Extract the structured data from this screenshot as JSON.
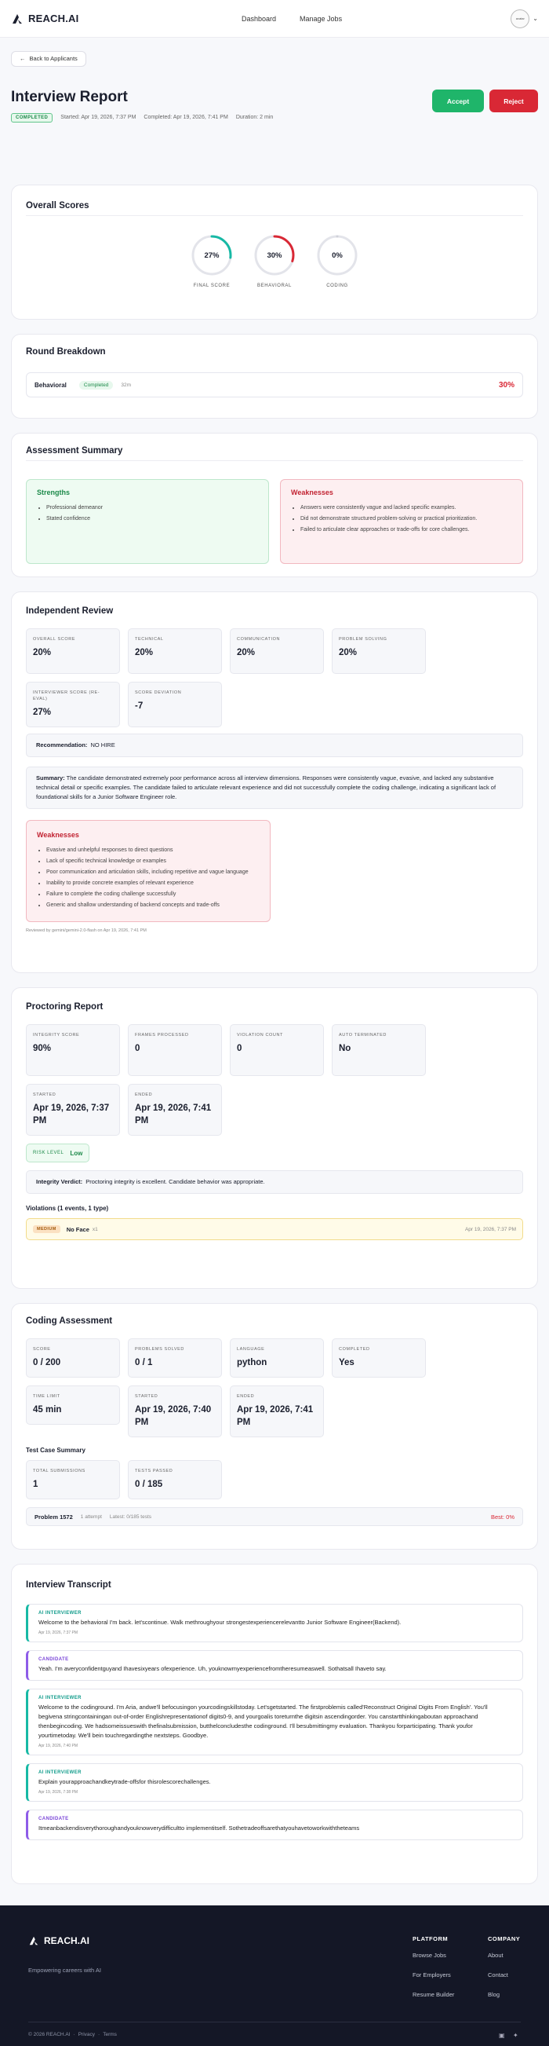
{
  "nav": {
    "brand": "REACH.AI",
    "links": [
      "Dashboard",
      "Manage Jobs"
    ],
    "avatar": "avatar"
  },
  "hero": {
    "back": "Back to Applicants",
    "title": "Interview Report",
    "status": "COMPLETED",
    "started": "Started: Apr 19, 2026, 7:37 PM",
    "completed": "Completed: Apr 19, 2026, 7:41 PM",
    "duration": "Duration: 2 min",
    "accept": "Accept",
    "reject": "Reject"
  },
  "overall": {
    "title": "Overall Scores",
    "gauges": [
      {
        "value": "27%",
        "label": "FINAL SCORE",
        "pct": 27,
        "color": "#17b9a5"
      },
      {
        "value": "30%",
        "label": "BEHAVIORAL",
        "pct": 30,
        "color": "#d92835"
      },
      {
        "value": "0%",
        "label": "CODING",
        "pct": 0,
        "color": "#cfd0d8"
      }
    ]
  },
  "rounds": {
    "title": "Round Breakdown",
    "items": [
      {
        "name": "Behavioral",
        "status": "Completed",
        "time": "32m",
        "score": "30%"
      }
    ]
  },
  "summary": {
    "title": "Assessment Summary",
    "strengths_title": "Strengths",
    "strengths": [
      "Professional demeanor",
      "Stated confidence"
    ],
    "weaknesses_title": "Weaknesses",
    "weaknesses": [
      "Answers were consistently vague and lacked specific examples.",
      "Did not demonstrate structured problem-solving or practical prioritization.",
      "Failed to articulate clear approaches or trade-offs for core challenges."
    ]
  },
  "review": {
    "title": "Independent Review",
    "metrics": [
      {
        "label": "OVERALL SCORE",
        "value": "20%"
      },
      {
        "label": "TECHNICAL",
        "value": "20%"
      },
      {
        "label": "COMMUNICATION",
        "value": "20%"
      },
      {
        "label": "PROBLEM SOLVING",
        "value": "20%"
      },
      {
        "label": "INTERVIEWER SCORE (RE-EVAL)",
        "value": "27%"
      },
      {
        "label": "SCORE DEVIATION",
        "value": "-7"
      }
    ],
    "rec_label": "Recommendation:",
    "rec_value": "NO HIRE",
    "summary_label": "Summary:",
    "summary_text": "The candidate demonstrated extremely poor performance across all interview dimensions. Responses were consistently vague, evasive, and lacked any substantive technical detail or specific examples. The candidate failed to articulate relevant experience and did not successfully complete the coding challenge, indicating a significant lack of foundational skills for a Junior Software Engineer role.",
    "weak_title": "Weaknesses",
    "weaknesses": [
      "Evasive and unhelpful responses to direct questions",
      "Lack of specific technical knowledge or examples",
      "Poor communication and articulation skills, including repetitive and vague language",
      "Inability to provide concrete examples of relevant experience",
      "Failure to complete the coding challenge successfully",
      "Generic and shallow understanding of backend concepts and trade-offs"
    ],
    "reviewed_by": "Reviewed by gemini/gemini-2.0-flash on Apr 19, 2026, 7:41 PM"
  },
  "proctor": {
    "title": "Proctoring Report",
    "metrics": [
      {
        "label": "INTEGRITY SCORE",
        "value": "90%"
      },
      {
        "label": "FRAMES PROCESSED",
        "value": "0"
      },
      {
        "label": "VIOLATION COUNT",
        "value": "0"
      },
      {
        "label": "AUTO TERMINATED",
        "value": "No"
      },
      {
        "label": "STARTED",
        "value": "Apr 19, 2026, 7:37 PM"
      },
      {
        "label": "ENDED",
        "value": "Apr 19, 2026, 7:41 PM"
      }
    ],
    "risk_label": "RISK LEVEL",
    "risk_value": "Low",
    "verdict_label": "Integrity Verdict:",
    "verdict_text": "Proctoring integrity is excellent. Candidate behavior was appropriate.",
    "violations_title": "Violations (1 events, 1 type)",
    "violation": {
      "severity": "MEDIUM",
      "name": "No Face",
      "count": "x1",
      "time": "Apr 19, 2026, 7:37 PM"
    }
  },
  "coding": {
    "title": "Coding Assessment",
    "metrics": [
      {
        "label": "SCORE",
        "value": "0 / 200"
      },
      {
        "label": "PROBLEMS SOLVED",
        "value": "0 / 1"
      },
      {
        "label": "LANGUAGE",
        "value": "python"
      },
      {
        "label": "COMPLETED",
        "value": "Yes"
      },
      {
        "label": "TIME LIMIT",
        "value": "45 min"
      },
      {
        "label": "STARTED",
        "value": "Apr 19, 2026, 7:40 PM"
      },
      {
        "label": "ENDED",
        "value": "Apr 19, 2026, 7:41 PM"
      }
    ],
    "tc_title": "Test Case Summary",
    "tc": [
      {
        "label": "TOTAL SUBMISSIONS",
        "value": "1"
      },
      {
        "label": "TESTS PASSED",
        "value": "0 / 185"
      }
    ],
    "problem": {
      "name": "Problem 1572",
      "attempts": "1 attempt",
      "latest": "Latest: 0/185 tests",
      "best": "Best: 0%"
    }
  },
  "transcript": {
    "title": "Interview Transcript",
    "messages": [
      {
        "role": "AI INTERVIEWER",
        "kind": "ai",
        "text": "Welcome to the behavioral I'm back. let'scontinue. Walk methroughyour strongestexperiencerelevantto Junior Software Engineer(Backend).",
        "time": "Apr 19, 2026, 7:37 PM"
      },
      {
        "role": "CANDIDATE",
        "kind": "cand",
        "text": "Yeah. I'm averyconfidentguyand Ihavesixyears ofexperience. Uh, youknowmyexperiencefromtheresumeaswell. Sothatsall Ihaveto say.",
        "time": ""
      },
      {
        "role": "AI INTERVIEWER",
        "kind": "ai",
        "text": "Welcome to the codinground. I'm Aria, andwe'll befocusingon yourcodingskillstoday. Let'sgetstarted. The firstproblemis called'Reconstruct Original Digits From English'. You'll begivena stringcontainingan out-of-order Englishrepresentationof digits0-9, and yourgoalis toreturnthe digitsin ascendingorder. You canstartthinkingaboutan approachand thenbegincoding. We hadsomeissueswith thefinalsubmission, butthelconcludesthe codinground. I'll besubmittingmy evaluation. Thankyou forparticipating. Thank youfor yourtimetoday. We'll bein touchregardingthe nextsteps. Goodbye.",
        "time": "Apr 19, 2026, 7:40 PM"
      },
      {
        "role": "AI INTERVIEWER",
        "kind": "ai",
        "text": "Explain yourapproachandkeytrade-offsfor thisrolescorechallenges.",
        "time": "Apr 19, 2026, 7:38 PM"
      },
      {
        "role": "CANDIDATE",
        "kind": "cand",
        "text": "Itmeanbackendisverythoroughandyouknowverydifficultto implementitself. Sothetradeoffsarethatyouhavetoworkwiththeteams",
        "time": ""
      }
    ]
  },
  "footer": {
    "brand": "REACH.AI",
    "tagline": "Empowering careers with AI",
    "platform_title": "PLATFORM",
    "platform": [
      "Browse Jobs",
      "For Employers",
      "Resume Builder"
    ],
    "company_title": "COMPANY",
    "company": [
      "About",
      "Contact",
      "Blog"
    ],
    "copyright": "© 2026 REACH.AI",
    "privacy": "Privacy",
    "terms": "Terms"
  }
}
